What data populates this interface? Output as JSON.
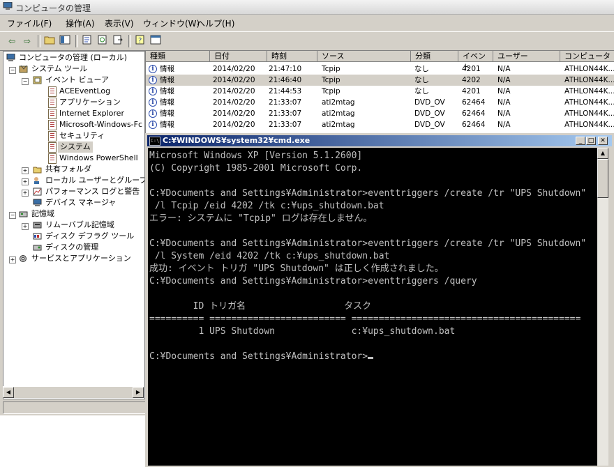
{
  "window": {
    "title": "コンピュータの管理"
  },
  "menu": [
    "ファイル(F)",
    "操作(A)",
    "表示(V)",
    "ウィンドウ(W)",
    "ヘルプ(H)"
  ],
  "tree": {
    "root": "コンピュータの管理 (ローカル)",
    "system_tools": "システム ツール",
    "event_viewer": "イベント ビューア",
    "logs": [
      "ACEEventLog",
      "アプリケーション",
      "Internet Explorer",
      "Microsoft-Windows-Fc",
      "セキュリティ",
      "システム",
      "Windows PowerShell"
    ],
    "shared_folders": "共有フォルダ",
    "local_users": "ローカル ユーザーとグループ",
    "perf_logs": "パフォーマンス ログと警告",
    "device_manager": "デバイス マネージャ",
    "storage": "記憶域",
    "removable": "リムーバブル記憶域",
    "defrag": "ディスク デフラグ ツール",
    "disk_mgmt": "ディスクの管理",
    "services_apps": "サービスとアプリケーション"
  },
  "events": {
    "columns": [
      "種類",
      "日付",
      "時刻",
      "ソース",
      "分類",
      "イベント",
      "ユーザー",
      "コンピュータ"
    ],
    "rows": [
      [
        "情報",
        "2014/02/20",
        "21:47:10",
        "Tcpip",
        "なし",
        "4201",
        "N/A",
        "ATHLON44K..."
      ],
      [
        "情報",
        "2014/02/20",
        "21:46:40",
        "Tcpip",
        "なし",
        "4202",
        "N/A",
        "ATHLON44K..."
      ],
      [
        "情報",
        "2014/02/20",
        "21:44:53",
        "Tcpip",
        "なし",
        "4201",
        "N/A",
        "ATHLON44K..."
      ],
      [
        "情報",
        "2014/02/20",
        "21:33:07",
        "ati2mtag",
        "DVD_OV",
        "62464",
        "N/A",
        "ATHLON44K..."
      ],
      [
        "情報",
        "2014/02/20",
        "21:33:07",
        "ati2mtag",
        "DVD_OV",
        "62464",
        "N/A",
        "ATHLON44K..."
      ],
      [
        "情報",
        "2014/02/20",
        "21:33:07",
        "ati2mtag",
        "DVD_OV",
        "62464",
        "N/A",
        "ATHLON44K..."
      ]
    ]
  },
  "cmd": {
    "title": "C:¥WINDOWS¥system32¥cmd.exe",
    "lines": [
      "Microsoft Windows XP [Version 5.1.2600]",
      "(C) Copyright 1985-2001 Microsoft Corp.",
      "",
      "C:¥Documents and Settings¥Administrator>eventtriggers /create /tr \"UPS Shutdown\"",
      " /l Tcpip /eid 4202 /tk c:¥ups_shutdown.bat",
      "エラー: システムに \"Tcpip\" ログは存在しません。",
      "",
      "C:¥Documents and Settings¥Administrator>eventtriggers /create /tr \"UPS Shutdown\"",
      " /l System /eid 4202 /tk c:¥ups_shutdown.bat",
      "成功: イベント トリガ \"UPS Shutdown\" は正しく作成されました。",
      "C:¥Documents and Settings¥Administrator>eventtriggers /query",
      "",
      "        ID トリガ名                  タスク",
      "========== ========================= ==========================================",
      "         1 UPS Shutdown              c:¥ups_shutdown.bat",
      "",
      "C:¥Documents and Settings¥Administrator>"
    ]
  }
}
